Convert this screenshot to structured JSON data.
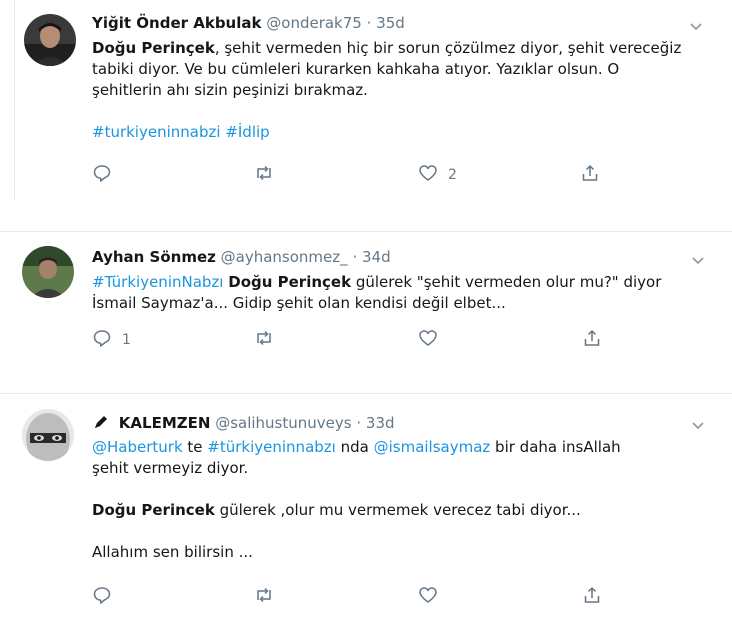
{
  "tweets": [
    {
      "name": "Yiğit Önder Akbulak",
      "handle": "@onderak75",
      "sep": "·",
      "time": "35d",
      "line1": {
        "bold": "Doğu Perinçek",
        "rest": ", şehit vermeden hiç bir sorun çözülmez diyor, şehit vereceğiz"
      },
      "line2": "tabiki diyor. Ve bu cümleleri kurarken kahkaha atıyor. Yazıklar olsun. O",
      "line3": "şehitlerin ahı sizin peşinizi bırakmaz.",
      "tags": [
        "#turkiyeninnabzi",
        "#İdlip"
      ],
      "actions": {
        "reply": "",
        "retweet": "",
        "like": "2"
      }
    },
    {
      "name": "Ayhan Sönmez",
      "handle": "@ayhansonmez_",
      "sep": "·",
      "time": "34d",
      "line1": {
        "tag": "#TürkiyeninNabzı",
        "bold": "Doğu Perinçek",
        "rest": " gülerek \"şehit vermeden olur mu?\" diyor"
      },
      "line2": "İsmail Saymaz'a... Gidip şehit olan kendisi değil elbet...",
      "actions": {
        "reply": "1",
        "retweet": "",
        "like": ""
      }
    },
    {
      "name": "KALEMZEN",
      "handle": "@salihustunuveys",
      "sep": "·",
      "time": "33d",
      "line1": {
        "mention1": "@Haberturk",
        "t1": " te ",
        "tag": "#türkiyeninnabzı",
        "t2": " nda ",
        "mention2": "@ismailsaymaz",
        "t3": " bir daha insAllah"
      },
      "line2": "şehit vermeyiz diyor.",
      "para2": {
        "bold": "Doğu Perincek",
        "rest": " gülerek ,olur mu vermemek verecez tabi diyor..."
      },
      "para3": "Allahım sen bilirsin ...",
      "actions": {
        "reply": "",
        "retweet": "",
        "like": ""
      }
    }
  ],
  "icons": {
    "reply": "reply-icon",
    "retweet": "retweet-icon",
    "like": "like-icon",
    "share": "share-icon",
    "more": "chevron-down-icon",
    "pen": "pen-icon"
  },
  "colors": {
    "link": "#1b95e0",
    "muted": "#657786",
    "text": "#14171a",
    "divider": "#e6ecf0"
  }
}
